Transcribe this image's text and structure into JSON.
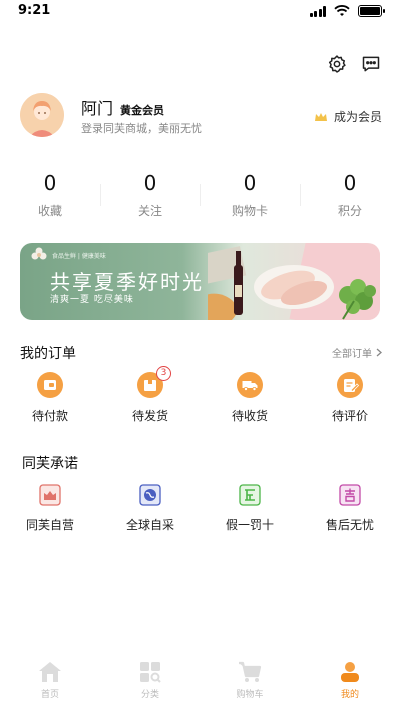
{
  "status_bar": {
    "time": "9:21"
  },
  "profile": {
    "username": "阿门",
    "member_level": "黄金会员",
    "subtitle": "登录同芙商城，美丽无忧",
    "become_member": "成为会员"
  },
  "stats": [
    {
      "value": "0",
      "label": "收藏"
    },
    {
      "value": "0",
      "label": "关注"
    },
    {
      "value": "0",
      "label": "购物卡"
    },
    {
      "value": "0",
      "label": "积分"
    }
  ],
  "banner": {
    "small_text": "食品生鲜 | 健康美味",
    "title": "共享夏季好时光",
    "subtitle": "清爽一夏 吃尽美味"
  },
  "orders": {
    "title": "我的订单",
    "see_all": "全部订单",
    "items": [
      {
        "label": "待付款",
        "icon": "wallet-icon"
      },
      {
        "label": "待发货",
        "icon": "package-icon",
        "badge": "3"
      },
      {
        "label": "待收货",
        "icon": "truck-icon"
      },
      {
        "label": "待评价",
        "icon": "review-icon"
      }
    ]
  },
  "promise": {
    "title": "同芙承诺",
    "items": [
      {
        "label": "同芙自营",
        "icon": "store-icon"
      },
      {
        "label": "全球自采",
        "icon": "globe-icon"
      },
      {
        "label": "假一罚十",
        "icon": "guarantee-icon"
      },
      {
        "label": "售后无忧",
        "icon": "after-sales-icon"
      }
    ]
  },
  "tab_bar": [
    {
      "label": "首页",
      "icon": "home-icon"
    },
    {
      "label": "分类",
      "icon": "category-icon"
    },
    {
      "label": "购物车",
      "icon": "cart-icon"
    },
    {
      "label": "我的",
      "icon": "profile-icon",
      "active": true
    }
  ],
  "colors": {
    "accent": "#f08a1c",
    "badge": "#e24444"
  }
}
